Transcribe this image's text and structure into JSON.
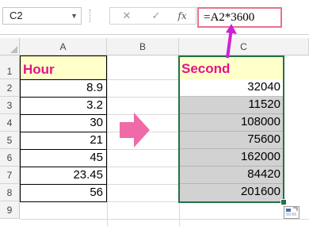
{
  "formula_bar": {
    "name_box": "C2",
    "cancel_symbol": "✕",
    "enter_symbol": "✓",
    "fx_symbol": "fx",
    "formula": "=A2*3600"
  },
  "columns": [
    "A",
    "B",
    "C"
  ],
  "rows": [
    "1",
    "2",
    "3",
    "4",
    "5",
    "6",
    "7",
    "8",
    "9"
  ],
  "sheet": {
    "a1": "Hour",
    "c1": "Second",
    "hours": [
      "8.9",
      "3.2",
      "30",
      "21",
      "45",
      "23.45",
      "56"
    ],
    "seconds": [
      "32040",
      "11520",
      "108000",
      "75600",
      "162000",
      "84420",
      "201600"
    ]
  },
  "colors": {
    "header_fill": "#ffffc9",
    "header_text": "#e0158a",
    "selection_fill": "#d2d2d2",
    "selection_border": "#217346",
    "arrow": "#f06aa8",
    "formula_highlight": "#e8738c",
    "pointer_arrow": "#d21fd6"
  },
  "icons": [
    "dropdown-icon",
    "cancel-icon",
    "enter-icon",
    "insert-function-icon",
    "right-arrow-icon",
    "pointer-arrow-icon",
    "quick-analysis-icon"
  ]
}
